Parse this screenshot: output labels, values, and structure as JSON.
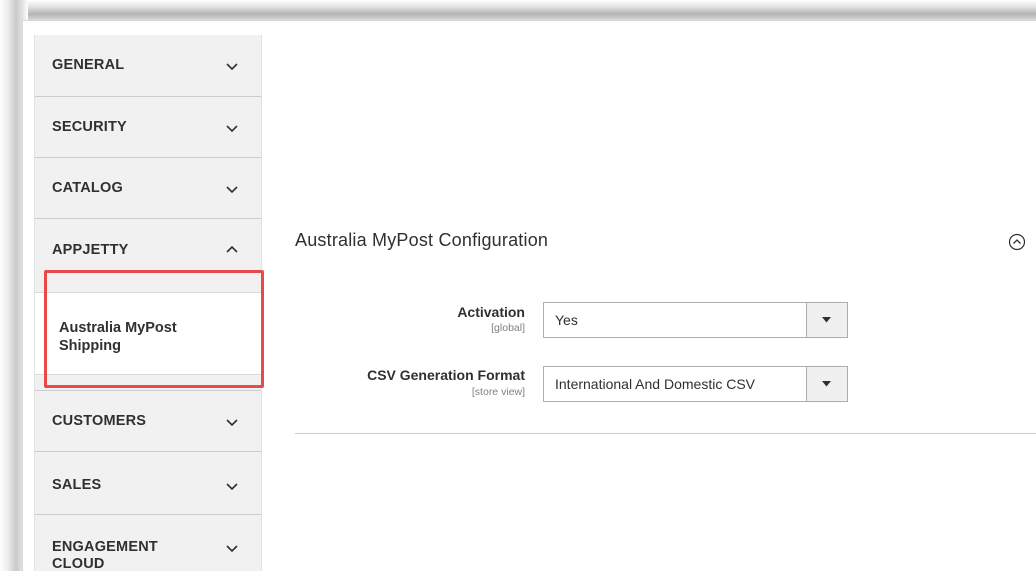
{
  "sidebar": {
    "items": [
      {
        "label": "GENERAL",
        "expanded": false
      },
      {
        "label": "SECURITY",
        "expanded": false
      },
      {
        "label": "CATALOG",
        "expanded": false
      },
      {
        "label": "APPJETTY",
        "expanded": true
      },
      {
        "label": "CUSTOMERS",
        "expanded": false
      },
      {
        "label": "SALES",
        "expanded": false
      },
      {
        "label": "ENGAGEMENT CLOUD",
        "expanded": false
      }
    ],
    "sub_item": {
      "label": "Australia MyPost Shipping"
    }
  },
  "section": {
    "title": "Australia MyPost Configuration",
    "fields": [
      {
        "label": "Activation",
        "scope": "[global]",
        "value": "Yes"
      },
      {
        "label": "CSV Generation Format",
        "scope": "[store view]",
        "value": "International And Domestic CSV"
      }
    ]
  },
  "colors": {
    "highlight": "#e84a4a",
    "sidebar_bg": "#f1f1f1",
    "text": "#303030"
  },
  "icons": {
    "chevron_down": "chevron-down-icon",
    "chevron_up": "chevron-up-icon",
    "collapse": "circle-chevron-up-icon",
    "select_arrow": "caret-down-icon"
  }
}
